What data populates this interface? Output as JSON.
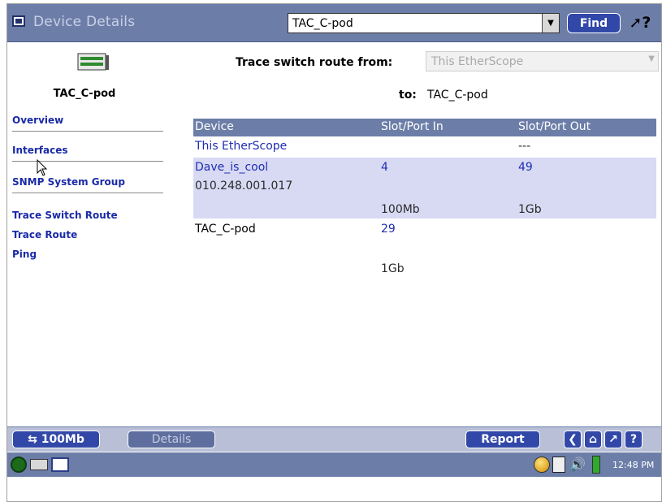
{
  "title_bar": {
    "title": "Device Details",
    "device_select_value": "TAC_C-pod",
    "find_label": "Find",
    "help_icon": "help-pointer-icon"
  },
  "sidebar": {
    "device_icon": "switch-icon",
    "device_name": "TAC_C-pod",
    "items": [
      {
        "label": "Overview"
      },
      {
        "label": "Interfaces"
      },
      {
        "label": "SNMP System Group"
      },
      {
        "label": "Trace Switch Route"
      },
      {
        "label": "Trace Route"
      },
      {
        "label": "Ping"
      }
    ]
  },
  "main": {
    "trace_from_label": "Trace switch route from:",
    "trace_from_value": "This EtherScope",
    "to_label": "to:",
    "to_value": "TAC_C-pod",
    "columns": [
      "Device",
      "Slot/Port In",
      "Slot/Port Out"
    ],
    "rows": [
      {
        "device": "This EtherScope",
        "port_in": "",
        "port_out": "---",
        "ip": "",
        "speed_in": "",
        "speed_out": ""
      },
      {
        "device": "Dave_is_cool",
        "port_in": "4",
        "port_out": "49",
        "ip": "010.248.001.017",
        "speed_in": "100Mb",
        "speed_out": "1Gb"
      },
      {
        "device": "TAC_C-pod",
        "port_in": "29",
        "port_out": "",
        "ip": "",
        "speed_in": "1Gb",
        "speed_out": ""
      }
    ]
  },
  "bottom_bar": {
    "link_speed": "100Mb",
    "details_label": "Details",
    "report_label": "Report",
    "help_label": "?"
  },
  "taskbar": {
    "clock": "12:48 PM"
  },
  "colors": {
    "title_bar": "#6c7ea8",
    "button_blue": "#3248a8",
    "link_blue": "#1a2aa8",
    "row_highlight": "#d8daf4"
  }
}
